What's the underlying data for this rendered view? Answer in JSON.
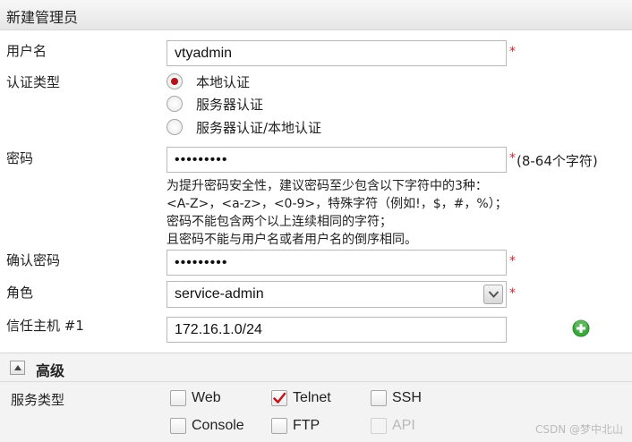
{
  "title": "新建管理员",
  "username": {
    "label": "用户名",
    "value": "vtyadmin",
    "required": "*"
  },
  "auth_type": {
    "label": "认证类型",
    "options": [
      {
        "label": "本地认证",
        "selected": true
      },
      {
        "label": "服务器认证",
        "selected": false
      },
      {
        "label": "服务器认证/本地认证",
        "selected": false
      }
    ]
  },
  "password": {
    "label": "密码",
    "value": "•••••••••",
    "required": "*",
    "hint": "(8-64个字符)",
    "help": [
      "为提升密码安全性，建议密码至少包含以下字符中的3种：",
      "<A-Z>，<a-z>，<0-9>，特殊字符（例如!，$，#，%）；",
      "密码不能包含两个以上连续相同的字符；",
      "且密码不能与用户名或者用户名的倒序相同。"
    ]
  },
  "confirm_password": {
    "label": "确认密码",
    "value": "•••••••••",
    "required": "*"
  },
  "role": {
    "label": "角色",
    "selected": "service-admin",
    "required": "*"
  },
  "trusted_host": {
    "label": "信任主机 #1",
    "value": "172.16.1.0/24"
  },
  "advanced": {
    "title": "高级",
    "service_label": "服务类型",
    "services": [
      {
        "label": "Web",
        "checked": false,
        "disabled": false
      },
      {
        "label": "Telnet",
        "checked": true,
        "disabled": false
      },
      {
        "label": "SSH",
        "checked": false,
        "disabled": false
      },
      {
        "label": "Console",
        "checked": false,
        "disabled": false
      },
      {
        "label": "FTP",
        "checked": false,
        "disabled": false
      },
      {
        "label": "API",
        "checked": false,
        "disabled": true
      }
    ]
  },
  "watermark": "CSDN @梦中北山",
  "colors": {
    "required": "#d0262e",
    "radio_selected": "#b5121b",
    "check_mark": "#c0151d",
    "add_icon": "#3aa83a"
  }
}
